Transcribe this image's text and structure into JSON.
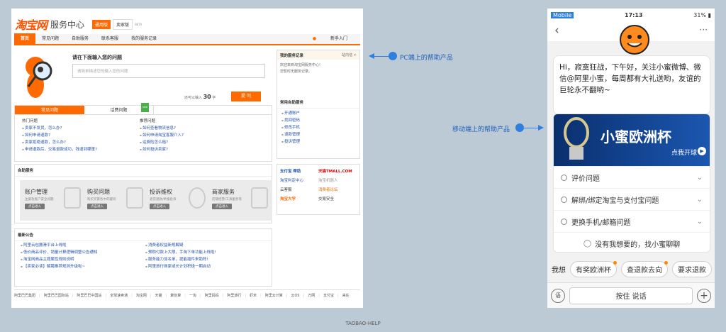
{
  "labels": {
    "pc_tag": "PC",
    "mobile_tag": "Mobile",
    "pc_annotation": "PC端上的帮助产品",
    "mobile_annotation": "移动端上的帮助产品",
    "footer": "TAOBAO-HELP"
  },
  "colors": {
    "accent": "#ff6a00",
    "annotation_blue": "#2f7fe0",
    "background": "#bccad6"
  },
  "pc": {
    "logo": "淘宝网",
    "logo_sub": "服务中心",
    "version_general": "通用版",
    "version_seller": "卖家版",
    "beta": "BETA",
    "nav": [
      "首页",
      "常见问题",
      "自助服务",
      "联系客服",
      "我的服务记录"
    ],
    "newbie": "新手入门",
    "ask": {
      "title": "请在下面输入您的问题",
      "placeholder": "请简单描述您的输入您的问题",
      "count_text": "还可以输入",
      "count": "30",
      "count_unit": "字",
      "button": "提 问"
    },
    "record": {
      "title": "我的服务记录",
      "inbox": "站内信 >",
      "text1": "欢迎来到淘宝网服务中心!",
      "text2": "您暂时无服务记录。"
    },
    "faq": {
      "tabs": [
        "常见问题",
        "话费问题"
      ],
      "new_badge": "new",
      "hot_title": "热门问题",
      "recommend_title": "推荐问题",
      "hot": [
        "卖家不发货，怎么办?",
        "如何申请退款?",
        "卖家拒绝退款，怎么办?",
        "申请退款后，交易退款成功，钱退到哪里?"
      ],
      "recommend": [
        "如何查看物流信息?",
        "如何申请淘宝客服介入?",
        "运费险怎么赔?",
        "如何投诉卖家?"
      ]
    },
    "self_service": {
      "title": "常用自助服务",
      "items": [
        "开通账户",
        "找回密码",
        "修改手机",
        "退款管理",
        "投诉管理"
      ]
    },
    "auto": {
      "title": "自助服务",
      "cards": [
        {
          "name": "账户管理",
          "desc": "注册及账户安全问题",
          "btn": "点击进入"
        },
        {
          "name": "购买问题",
          "desc": "购买买家各中的疑问",
          "btn": "点击进入"
        },
        {
          "name": "投诉维权",
          "desc": "退货退款/举报投诉",
          "btn": "点击进入"
        },
        {
          "name": "商家服务",
          "desc": "店铺经营/工具服务等",
          "btn": "点击进入"
        }
      ]
    },
    "partners": [
      "支付宝 帮助",
      "天猫TMALL.COM",
      "淘宝判定中心",
      "淘宝机器人",
      "云客服",
      "消费者论坛",
      "淘宝大学",
      "交易安全"
    ],
    "notice": {
      "title": "最新公告",
      "left": [
        "阿里云包搬滑平台上线啦",
        "低价商品评价、销量计算逻辑调整公告通知",
        "淘宝网商品主题属性规则说明",
        "【卖家必读】解聘推荐规则升级啦~"
      ],
      "right": [
        "消费者权益新规解疑",
        "预购付款上大限，手淘下单功能上线啦!",
        "服务能力加名单，提能插件来助阵!",
        "阿里旅行商家或长计划积极一期启动"
      ]
    },
    "footer_links": [
      "阿里巴巴集团",
      "阿里巴巴国际站",
      "阿里巴巴中国站",
      "全球速卖通",
      "淘宝网",
      "天猫",
      "聚划算",
      "一淘",
      "阿里妈妈",
      "阿里旅行",
      "虾米",
      "阿里云计算",
      "云OS",
      "万网",
      "支付宝",
      "来往"
    ]
  },
  "mobile": {
    "status": {
      "carrier": "Mobile",
      "time": "17:13",
      "battery": "31%"
    },
    "greeting": "Hi，寂寞狂战，下午好，关注小蜜微博、微信@阿里小蜜，每周都有大礼送哟，友谊的巨轮永不翻哟~",
    "banner": {
      "title": "小蜜欧洲杯",
      "sub": "点我开球"
    },
    "items": [
      "评价问题",
      "解绑/绑定淘宝与支付宝问题",
      "更换手机/邮箱问题"
    ],
    "chat_link": "没有我想要的，找小蜜聊聊",
    "chips_label": "我想",
    "chips": [
      "有奖欧洲杯",
      "查退款去向",
      "要求退款"
    ],
    "input_hint": "按住 说话",
    "voice_btn": "语",
    "plus_btn": "+"
  }
}
